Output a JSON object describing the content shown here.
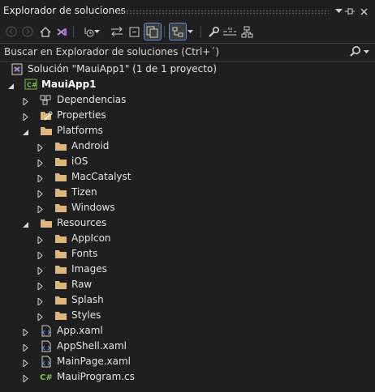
{
  "panel": {
    "title": "Explorador de soluciones"
  },
  "search": {
    "placeholder": "Buscar en Explorador de soluciones (Ctrl+´)"
  },
  "tree": {
    "solution": "Solución \"MauiApp1\"  (1 de 1 proyecto)",
    "project": "MauiApp1",
    "dependencies": "Dependencias",
    "properties": "Properties",
    "platforms": "Platforms",
    "android": "Android",
    "ios": "iOS",
    "maccatalyst": "MacCatalyst",
    "tizen": "Tizen",
    "windows": "Windows",
    "resources": "Resources",
    "appicon": "AppIcon",
    "fonts": "Fonts",
    "images": "Images",
    "raw": "Raw",
    "splash": "Splash",
    "styles": "Styles",
    "app_xaml": "App.xaml",
    "appshell_xaml": "AppShell.xaml",
    "mainpage_xaml": "MainPage.xaml",
    "mauiprogram_cs": "MauiProgram.cs"
  },
  "colors": {
    "folder": "#dcb67a",
    "accent": "#3794ff",
    "csharp": "#7ec14a"
  }
}
